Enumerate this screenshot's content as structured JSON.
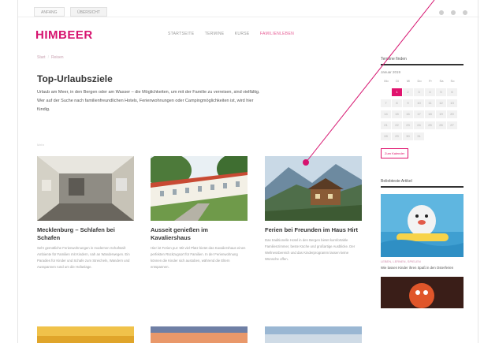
{
  "topbar": {
    "tabs": [
      "ANFANG",
      "ÜBERSICHT"
    ],
    "icons": [
      "share-icon",
      "user-icon",
      "menu-icon"
    ]
  },
  "brand": {
    "logo": "HIMBEER",
    "accent": "#d6136f"
  },
  "nav": {
    "items": [
      "STARTSEITE",
      "TERMINE",
      "KURSE",
      "FAMILIENLEBEN"
    ],
    "active_index": 3
  },
  "breadcrumb": {
    "home": "Start",
    "current": "Reisen"
  },
  "main": {
    "title": "Top-Urlaubsziele",
    "intro": "Urlaub am Meer, in den Bergen oder am Wasser – die Möglichkeiten, um mit der Familie zu verreisen, sind vielfältig. Wer auf der Suche nach familienfreundlichen Hotels, Ferienwohnungen oder Campingmöglichkeiten ist, wird hier fündig.",
    "more": "Mehr"
  },
  "cards": [
    {
      "title": "Mecklenburg – Schlafen bei Schafen",
      "text": "Sehr gemütliche Ferienwohnungen in modernen Schafstall-Ambiente für Familien mit Kindern, nah an Wanderwegen. Ein Paradies für Kinder und Schafe zum Streicheln, Wandern und Ausspannen rund um die Hofanlage."
    },
    {
      "title": "Ausseit genießen im Kavaliershaus",
      "text": "Hier ist Ferien pur: Mit viel Platz bietet das Kavaliershaus einen perfekten Rückzugsort für Familien. In der Ferienwohnung können die Kinder sich austoben, während die Eltern entspannen."
    },
    {
      "title": "Ferien bei Freunden im Haus Hirt",
      "text": "Das traditionelle Hotel in den Bergen bietet komfortable Familienzimmer, beste Küche und großartige Ausblicke. Der Wellnessbereich und das Kinderprogramm lassen keine Wünsche offen."
    }
  ],
  "sidebar": {
    "calendar_title": "Termine finden",
    "month": "Januar 2019",
    "weekdays": [
      "Mo",
      "Di",
      "Mi",
      "Do",
      "Fr",
      "Sa",
      "So"
    ],
    "weeks": [
      [
        "",
        "1",
        "2",
        "3",
        "4",
        "5",
        "6"
      ],
      [
        "7",
        "8",
        "9",
        "10",
        "11",
        "12",
        "13"
      ],
      [
        "14",
        "15",
        "16",
        "17",
        "18",
        "19",
        "20"
      ],
      [
        "21",
        "22",
        "23",
        "24",
        "25",
        "26",
        "27"
      ],
      [
        "28",
        "29",
        "30",
        "31",
        "",
        "",
        ""
      ]
    ],
    "today": "1",
    "calendar_button": "Zum Kalender",
    "popular_title": "Beliebteste Artikel",
    "popular_caption": "LEBEN, LERNEN, SPIELEN",
    "popular_headline": "Wie lassen Kinder ihren Spaß in den Osterferien"
  }
}
